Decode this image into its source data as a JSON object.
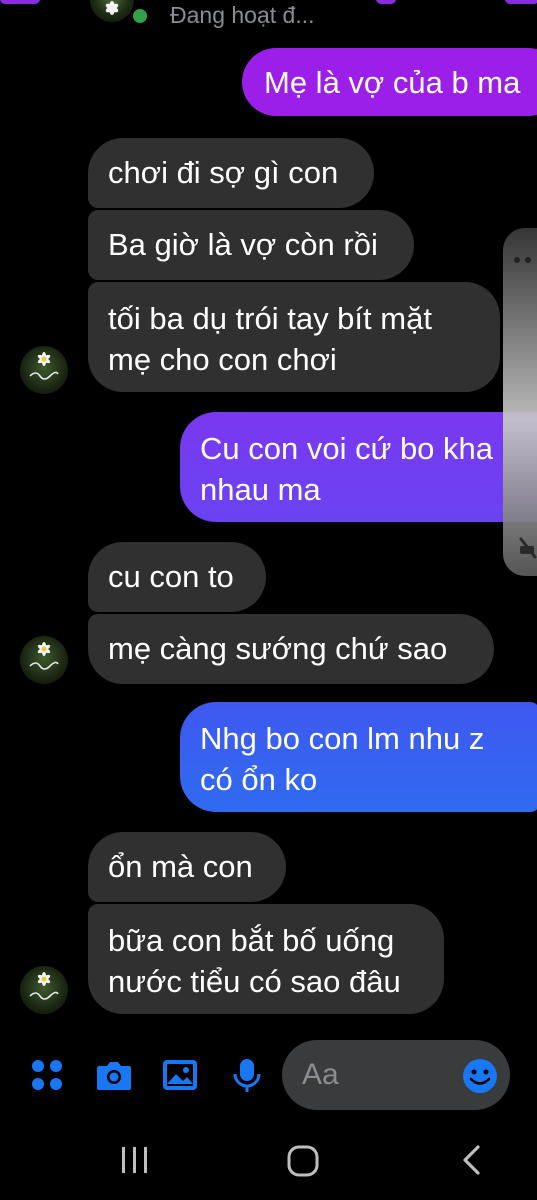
{
  "header": {
    "status": "Đang hoạt đ..."
  },
  "messages": [
    {
      "id": "m1",
      "dir": "out",
      "text": "Mẹ là vợ của b ma"
    },
    {
      "id": "m2",
      "dir": "in",
      "text": "chơi đi sợ gì con"
    },
    {
      "id": "m3",
      "dir": "in",
      "text": "Ba giờ là vợ còn rồi"
    },
    {
      "id": "m4",
      "dir": "in",
      "lines": [
        "tối ba dụ trói tay bít mặt",
        "mẹ cho con chơi"
      ]
    },
    {
      "id": "m5",
      "dir": "out",
      "lines": [
        "Cu con voi cứ bo kha",
        "nhau ma"
      ]
    },
    {
      "id": "m6",
      "dir": "in",
      "text": "cu con to"
    },
    {
      "id": "m7",
      "dir": "in",
      "text": "mẹ càng sướng chứ sao"
    },
    {
      "id": "m8",
      "dir": "out",
      "lines": [
        "Nhg bo con lm nhu z",
        "có ổn ko"
      ]
    },
    {
      "id": "m9",
      "dir": "in",
      "text": "ổn mà con"
    },
    {
      "id": "m10",
      "dir": "in",
      "lines": [
        "bữa con bắt bố uống",
        "nước tiểu có sao đâu"
      ]
    }
  ],
  "composer": {
    "placeholder": "Aa",
    "icons": [
      "apps-icon",
      "camera-icon",
      "image-icon",
      "microphone-icon",
      "emoji-icon"
    ]
  },
  "colors": {
    "background": "#000000",
    "incoming_bubble": "#303030",
    "outgoing_top": "#8a2be2",
    "outgoing_bottom": "#2f6bf0",
    "accent": "#1877f2"
  }
}
